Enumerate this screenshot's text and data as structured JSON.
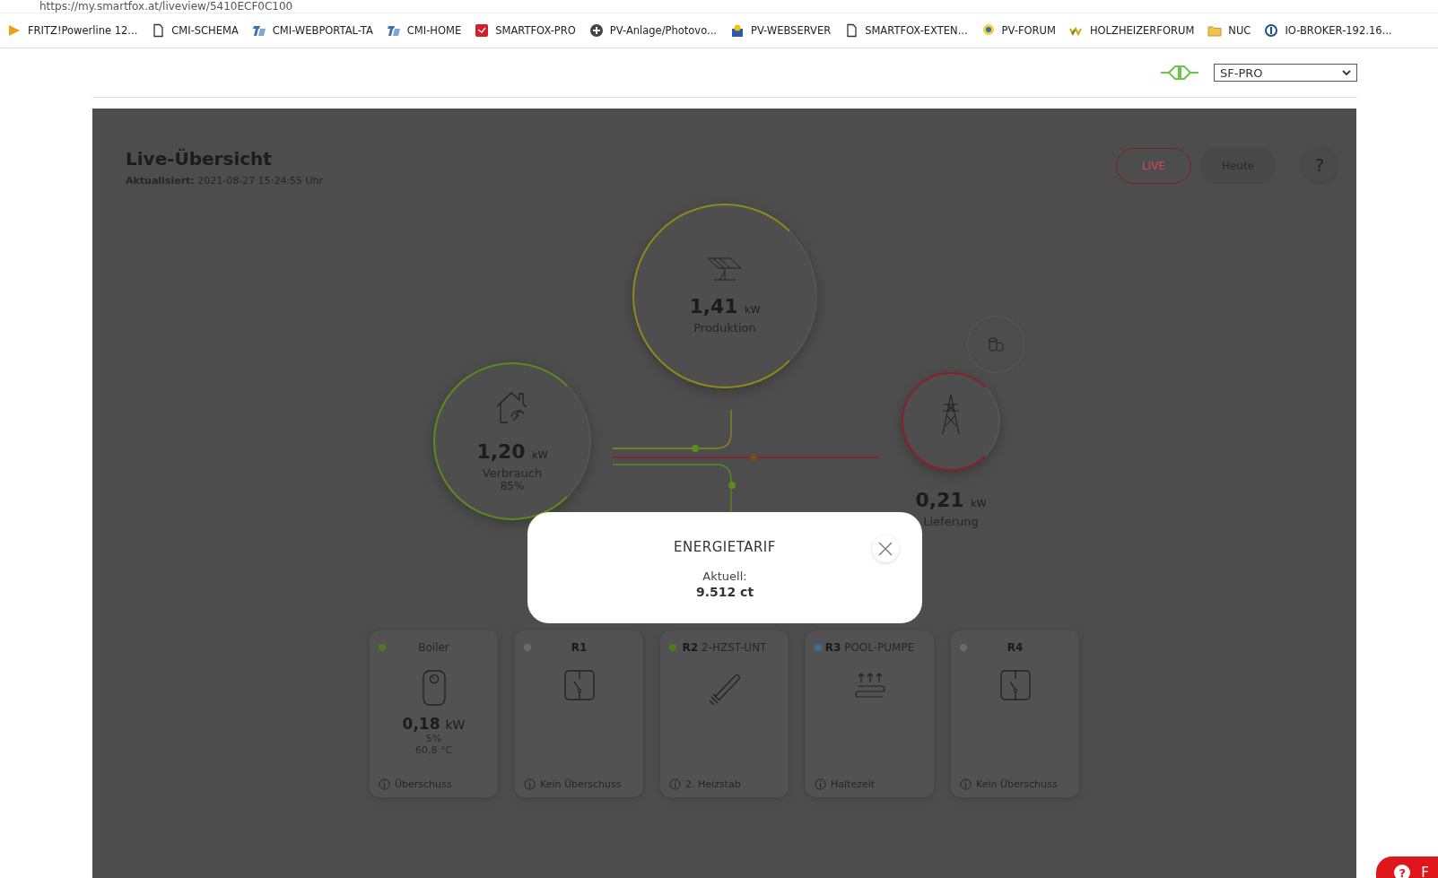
{
  "browser": {
    "url": "https://my.smartfox.at/liveview/5410ECF0C100",
    "bookmarks": [
      {
        "label": "FRITZ!Powerline 12...",
        "kind": "arrow"
      },
      {
        "label": "CMI-SCHEMA",
        "kind": "doc"
      },
      {
        "label": "CMI-WEBPORTAL-TA",
        "kind": "ta"
      },
      {
        "label": "CMI-HOME",
        "kind": "ta"
      },
      {
        "label": "SMARTFOX-PRO",
        "kind": "redsquare"
      },
      {
        "label": "PV-Anlage/Photovo...",
        "kind": "plus"
      },
      {
        "label": "PV-WEBSERVER",
        "kind": "sun"
      },
      {
        "label": "SMARTFOX-EXTEN...",
        "kind": "doc"
      },
      {
        "label": "PV-FORUM",
        "kind": "bulb"
      },
      {
        "label": "HOLZHEIZERFORUM",
        "kind": "wave"
      },
      {
        "label": "NUC",
        "kind": "folder"
      },
      {
        "label": "IO-BROKER-192.16...",
        "kind": "ring"
      }
    ]
  },
  "header": {
    "device_select": "SF-PRO"
  },
  "live": {
    "title": "Live-Übersicht",
    "updated_label": "Aktualisiert:",
    "updated_value": "2021-08-27 15:24:55 Uhr",
    "tabs": [
      {
        "label": "LIVE",
        "selected": true
      },
      {
        "label": "Heute",
        "selected": false
      }
    ],
    "help": "?"
  },
  "nodes": [
    {
      "kind": "production",
      "value": "1,41",
      "unit": "kW",
      "label": "Produktion",
      "color": "#8c8a1c"
    },
    {
      "kind": "consumption",
      "value": "1,20",
      "unit": "kW",
      "label": "Verbrauch",
      "share": "85%",
      "color": "#5b8a1e"
    },
    {
      "kind": "grid",
      "value": "0,21",
      "unit": "kW",
      "label": "Lieferung",
      "color": "#8c1f2a"
    }
  ],
  "relays": [
    {
      "name": "Boiler",
      "kind": "boiler",
      "color": "#4e7a1e",
      "value": "0,18",
      "unit": "kW",
      "share": "5%",
      "temperature": "60,8 °C",
      "status": "Überschuss"
    },
    {
      "code": "R1",
      "kind": "switch",
      "color": "#6a6a6a",
      "status": "Kein Überschuss"
    },
    {
      "code": "R2",
      "name": "2-HZST-UNT",
      "kind": "heater",
      "color": "#4e7a1e",
      "status": "2. Heizstab"
    },
    {
      "code": "R3",
      "name": "POOL-PUMPE",
      "kind": "floor",
      "color": "#3a6e96",
      "status": "Haltezeit"
    },
    {
      "code": "R4",
      "kind": "switch",
      "color": "#6a6a6a",
      "status": "Kein Überschuss"
    }
  ],
  "dialog": {
    "title": "ENERGIETARIF",
    "label": "Aktuell:",
    "value": "9.512 ct"
  },
  "help_button": {
    "icon": "?",
    "label": "F"
  }
}
